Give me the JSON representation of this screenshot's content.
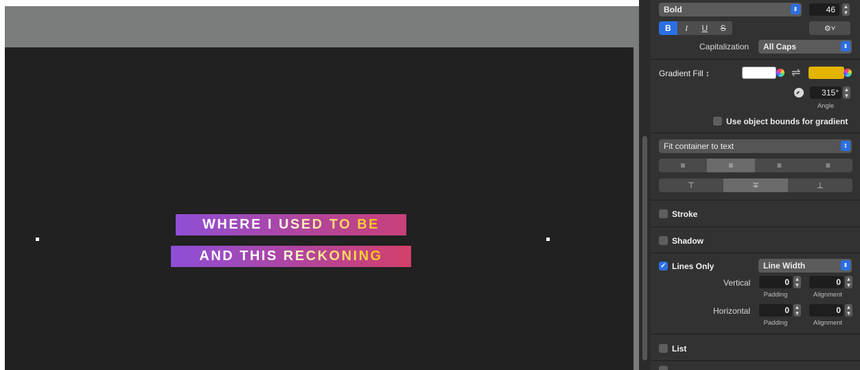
{
  "canvas": {
    "lines": [
      "WHERE I USED TO BE",
      "AND THIS RECKONING"
    ]
  },
  "font": {
    "typeface_label": "Bold",
    "size": "46",
    "format_buttons": [
      "B",
      "I",
      "U",
      "S"
    ],
    "action_icon": "gear-icon",
    "capitalization_label": "Capitalization",
    "capitalization_value": "All Caps"
  },
  "fill": {
    "label": "Gradient Fill ↕",
    "color_start": "#ffffff",
    "color_end": "#e3b400",
    "swap_icon": "⇌",
    "angle_value": "315°",
    "angle_label": "Angle",
    "object_bounds_label": "Use object bounds for gradient",
    "object_bounds_checked": false
  },
  "layout": {
    "fit_value": "Fit container to text",
    "horizontal_align": [
      "align-left",
      "align-center",
      "align-right",
      "align-justify"
    ],
    "horizontal_selected": "align-center",
    "vertical_align": [
      "align-top",
      "align-middle",
      "align-bottom"
    ],
    "vertical_selected": "align-middle"
  },
  "stroke": {
    "label": "Stroke",
    "checked": false
  },
  "shadow": {
    "label": "Shadow",
    "checked": false
  },
  "lines_only": {
    "label": "Lines Only",
    "checked": true,
    "mode_value": "Line Width",
    "vertical_label": "Vertical",
    "vertical_padding": "0",
    "vertical_alignment": "0",
    "horizontal_label": "Horizontal",
    "horizontal_padding": "0",
    "horizontal_alignment": "0",
    "padding_caption": "Padding",
    "alignment_caption": "Alignment"
  },
  "list": {
    "label": "List",
    "checked": false
  },
  "colors": {
    "accent": "#2c6fe3",
    "canvas": "#212121",
    "inspector": "#323232"
  }
}
